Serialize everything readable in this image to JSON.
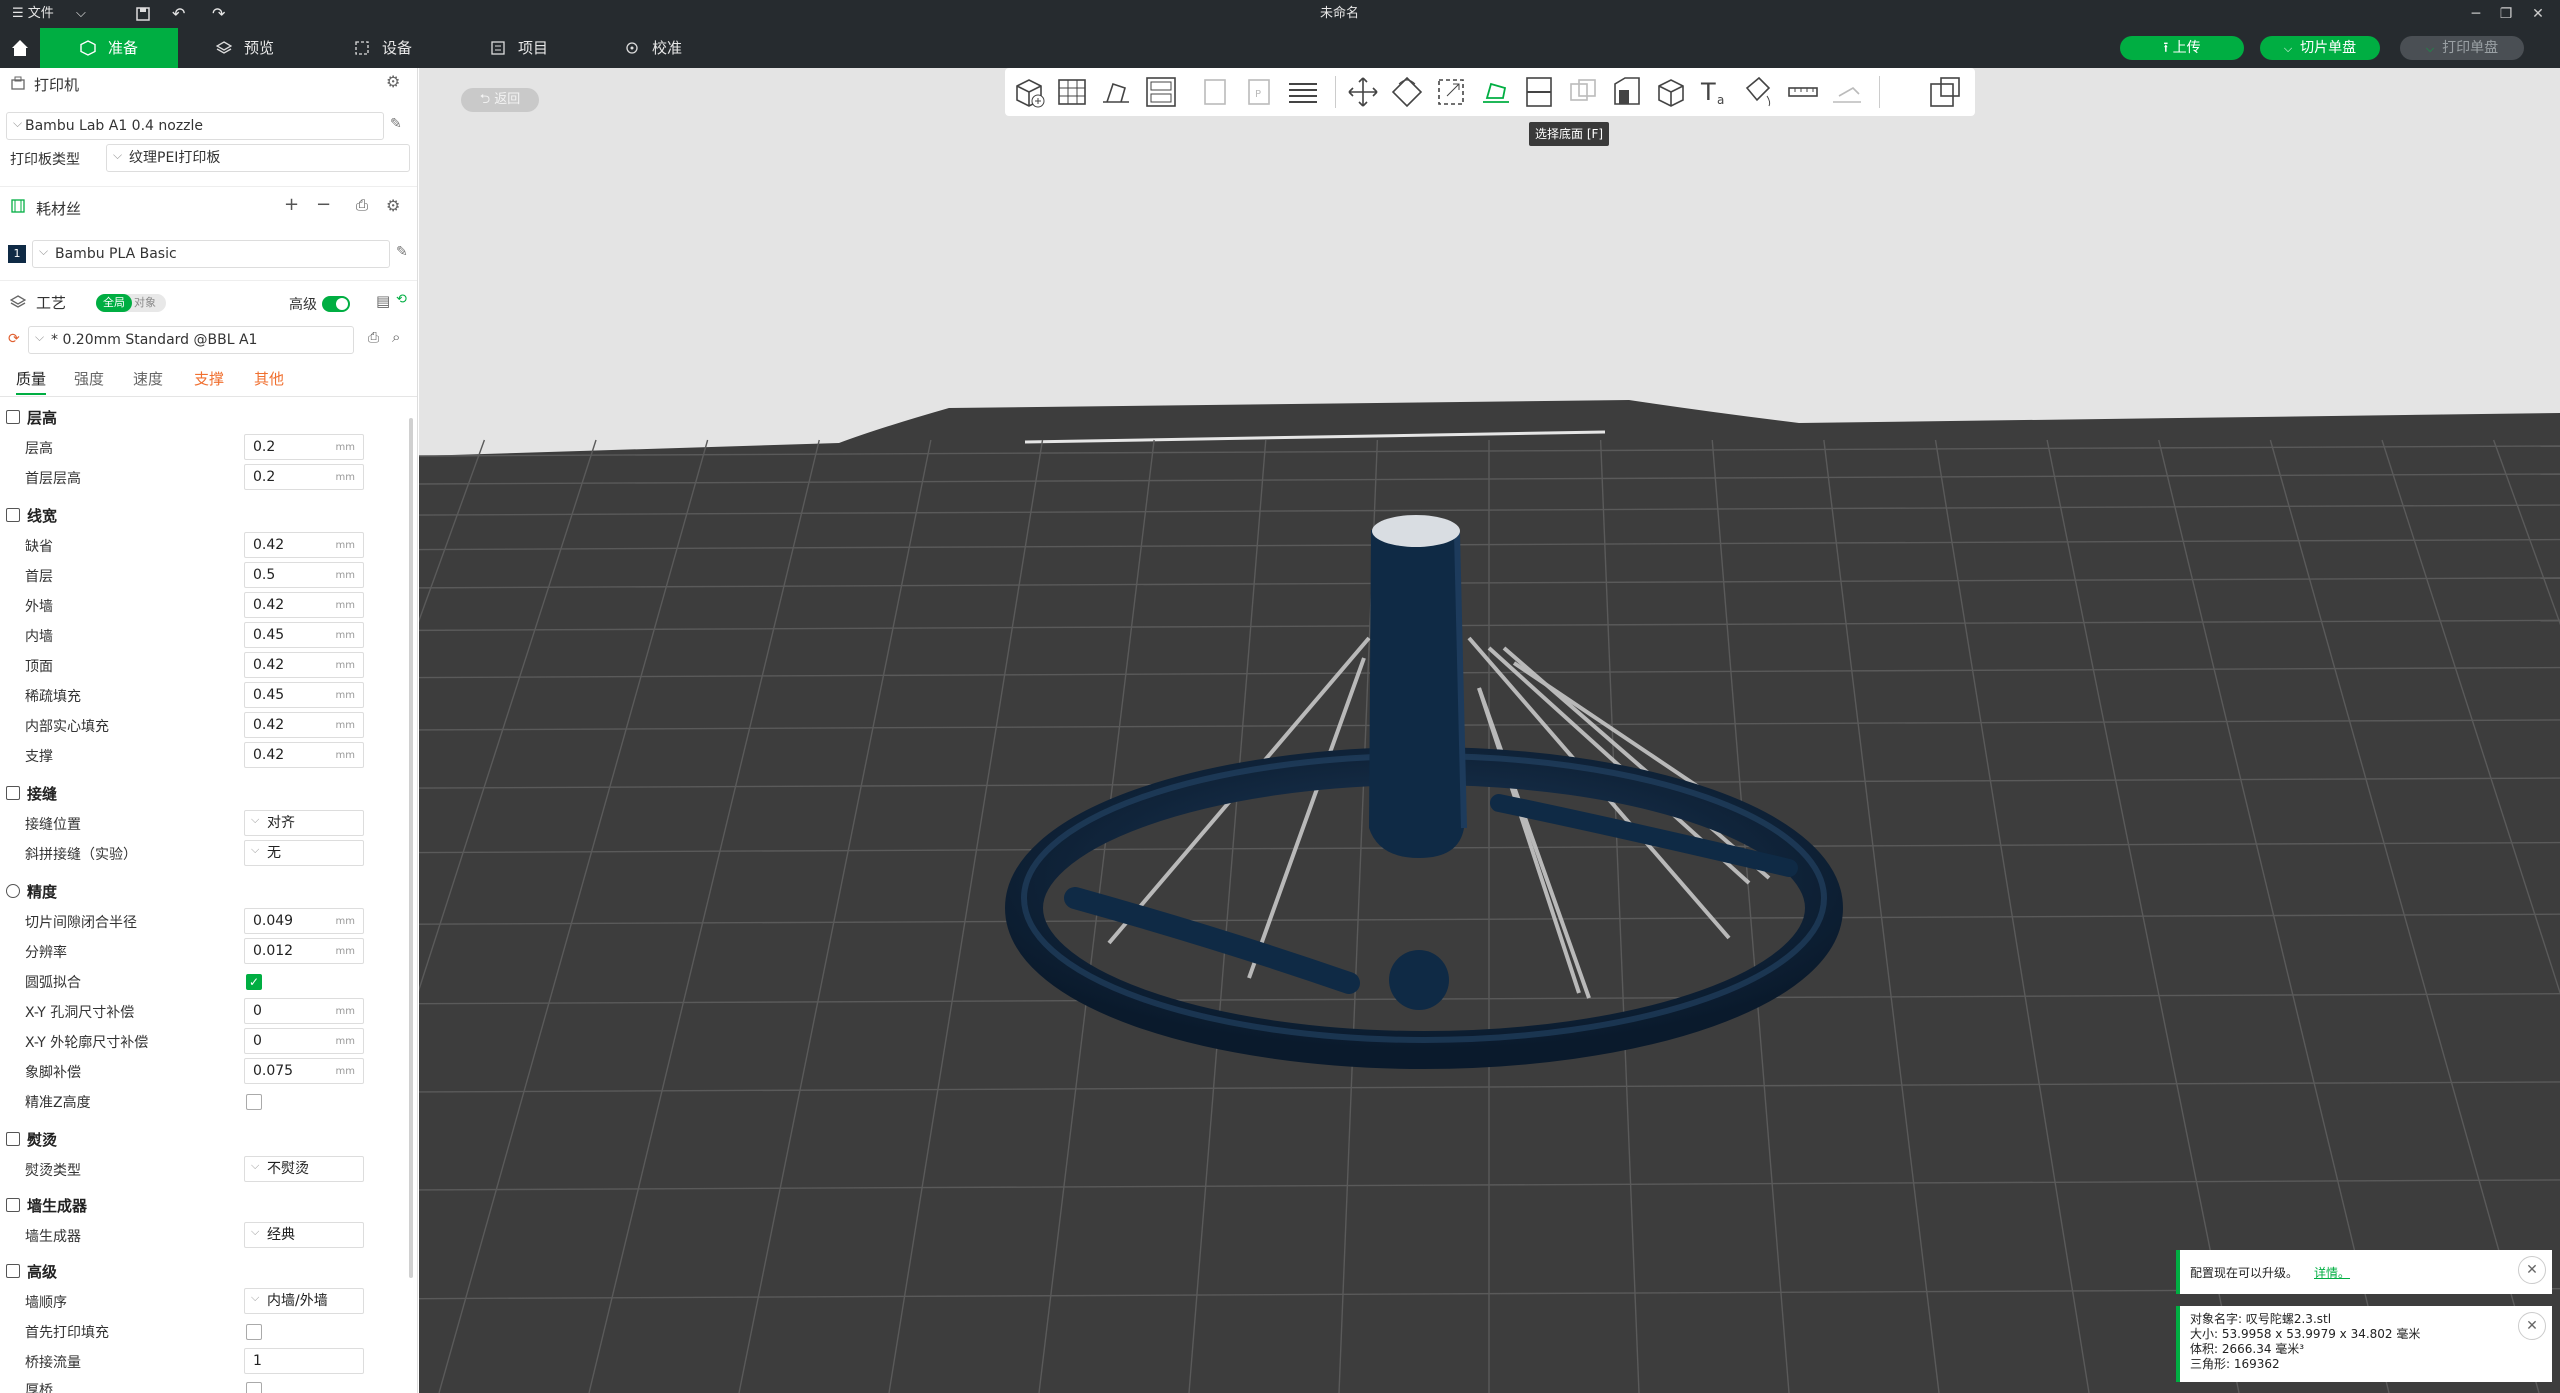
{
  "titlebar": {
    "menu_label": "文件",
    "title": "未命名"
  },
  "tabs": [
    {
      "label": "准备"
    },
    {
      "label": "预览"
    },
    {
      "label": "设备"
    },
    {
      "label": "项目"
    },
    {
      "label": "校准"
    }
  ],
  "actions": {
    "upload": "上传",
    "slice": "切片单盘",
    "print": "打印单盘"
  },
  "printer": {
    "section": "打印机",
    "preset": "Bambu Lab A1 0.4 nozzle",
    "plate_label": "打印板类型",
    "plate_value": "纹理PEI打印板"
  },
  "filament": {
    "section": "耗材丝",
    "slot": "1",
    "slot_color": "#0f2a45",
    "name": "Bambu PLA Basic"
  },
  "process": {
    "section": "工艺",
    "toggle_global": "全局",
    "toggle_object": "对象",
    "advanced": "高级",
    "preset": "* 0.20mm Standard @BBL A1",
    "subtabs": [
      "质量",
      "强度",
      "速度",
      "支撑",
      "其他"
    ]
  },
  "groups": {
    "layer": "层高",
    "width": "线宽",
    "seam": "接缝",
    "precision": "精度",
    "ironing": "熨烫",
    "wallgen": "墙生成器",
    "advanced": "高级"
  },
  "settings": {
    "layer_height": {
      "label": "层高",
      "value": "0.2",
      "unit": "mm"
    },
    "first_layer_height": {
      "label": "首层层高",
      "value": "0.2",
      "unit": "mm"
    },
    "lw_default": {
      "label": "缺省",
      "value": "0.42",
      "unit": "mm"
    },
    "lw_first": {
      "label": "首层",
      "value": "0.5",
      "unit": "mm"
    },
    "lw_outer": {
      "label": "外墙",
      "value": "0.42",
      "unit": "mm"
    },
    "lw_inner": {
      "label": "内墙",
      "value": "0.45",
      "unit": "mm"
    },
    "lw_top": {
      "label": "顶面",
      "value": "0.42",
      "unit": "mm"
    },
    "lw_sparse": {
      "label": "稀疏填充",
      "value": "0.45",
      "unit": "mm"
    },
    "lw_solid": {
      "label": "内部实心填充",
      "value": "0.42",
      "unit": "mm"
    },
    "lw_support": {
      "label": "支撑",
      "value": "0.42",
      "unit": "mm"
    },
    "seam_pos": {
      "label": "接缝位置",
      "value": "对齐"
    },
    "seam_scarf": {
      "label": "斜拼接缝（实验）",
      "value": "无"
    },
    "gap_close": {
      "label": "切片间隙闭合半径",
      "value": "0.049",
      "unit": "mm"
    },
    "resolution": {
      "label": "分辨率",
      "value": "0.012",
      "unit": "mm"
    },
    "arc_fit": {
      "label": "圆弧拟合"
    },
    "xy_hole": {
      "label": "X-Y 孔洞尺寸补偿",
      "value": "0",
      "unit": "mm"
    },
    "xy_contour": {
      "label": "X-Y 外轮廓尺寸补偿",
      "value": "0",
      "unit": "mm"
    },
    "elephant": {
      "label": "象脚补偿",
      "value": "0.075",
      "unit": "mm"
    },
    "precise_z": {
      "label": "精准Z高度"
    },
    "ironing_type": {
      "label": "熨烫类型",
      "value": "不熨烫"
    },
    "wall_generator": {
      "label": "墙生成器",
      "value": "经典"
    },
    "wall_order": {
      "label": "墙顺序",
      "value": "内墙/外墙"
    },
    "infill_first": {
      "label": "首先打印填充"
    },
    "bridge_flow": {
      "label": "桥接流量",
      "value": "1"
    },
    "thick_bridge": {
      "label": "厚桥"
    }
  },
  "viewport": {
    "return_label": "返回",
    "tooltip": "选择底面 [F]",
    "model_color": "#0f2a45",
    "plate_color": "#3d3d3d"
  },
  "notifications": {
    "upgrade_text": "配置现在可以升级。",
    "upgrade_link": "详情。",
    "obj_name": "对象名字:  叹号陀螺2.3.stl",
    "obj_size": "大小:    53.9958 x 53.9979 x 34.802 毫米",
    "obj_volume": "体积:    2666.34 毫米³",
    "obj_tris": "三角形:  169362"
  }
}
